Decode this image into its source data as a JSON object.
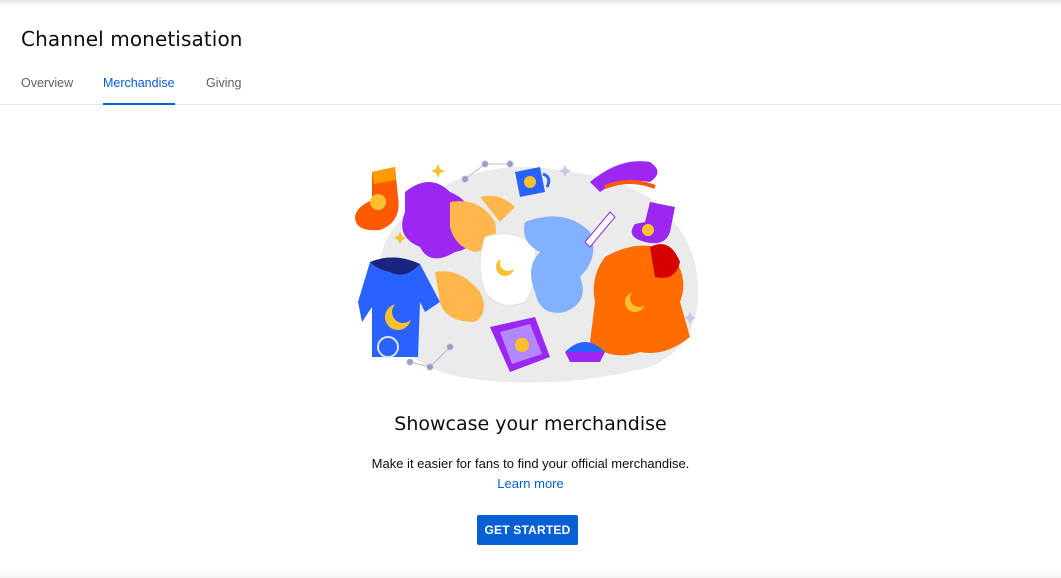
{
  "page": {
    "title": "Channel monetisation"
  },
  "tabs": [
    {
      "label": "Overview",
      "active": false
    },
    {
      "label": "Merchandise",
      "active": true
    },
    {
      "label": "Giving",
      "active": false
    }
  ],
  "merchandise": {
    "headline": "Showcase your merchandise",
    "description": "Make it easier for fans to find your official merchandise.",
    "learn_more": "Learn more",
    "cta_label": "GET STARTED"
  },
  "colors": {
    "accent": "#065fd4",
    "text_primary": "#0d0d0d",
    "text_secondary": "#606060"
  }
}
